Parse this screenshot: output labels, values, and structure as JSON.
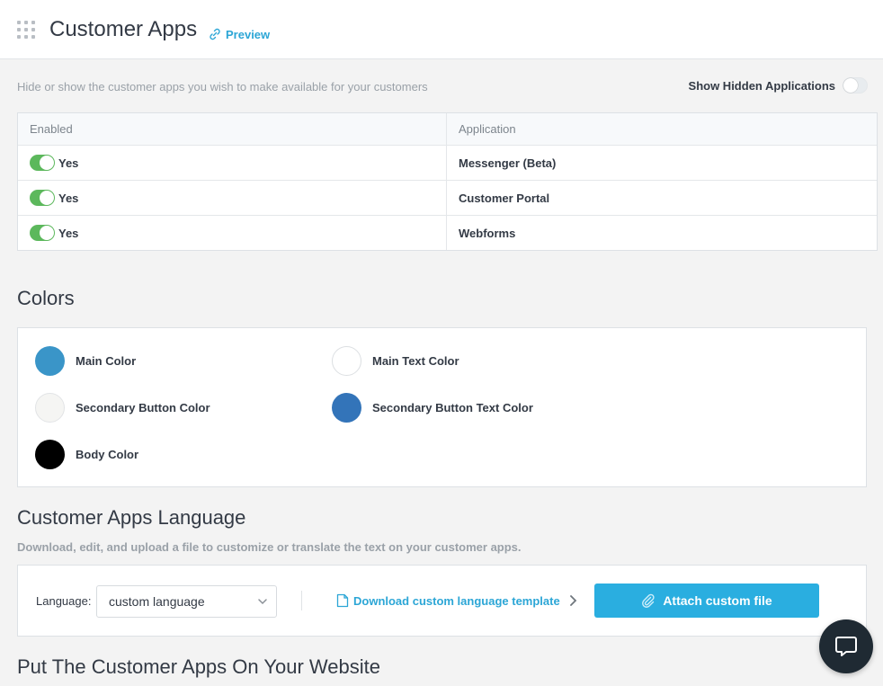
{
  "header": {
    "title": "Customer Apps",
    "preview_label": "Preview"
  },
  "apps": {
    "description": "Hide or show the customer apps you wish to make available for your customers",
    "show_hidden_label": "Show Hidden Applications",
    "show_hidden_enabled": false,
    "columns": [
      "Enabled",
      "Application"
    ],
    "rows": [
      {
        "enabled": "Yes",
        "application": "Messenger (Beta)"
      },
      {
        "enabled": "Yes",
        "application": "Customer Portal"
      },
      {
        "enabled": "Yes",
        "application": "Webforms"
      }
    ]
  },
  "colors": {
    "title": "Colors",
    "items": [
      {
        "label": "Main Color",
        "value": "#3a95c8"
      },
      {
        "label": "Main Text Color",
        "value": "#ffffff"
      },
      {
        "label": "Secondary Button Color",
        "value": "#f5f5f3"
      },
      {
        "label": "Secondary Button Text Color",
        "value": "#3374b9"
      },
      {
        "label": "Body Color",
        "value": "#000000"
      }
    ]
  },
  "language": {
    "title": "Customer Apps Language",
    "description": "Download, edit, and upload a file to customize or translate the text on your customer apps.",
    "label": "Language:",
    "selected": "custom language",
    "download_label": "Download custom language template",
    "attach_label": "Attach custom file"
  },
  "website": {
    "title": "Put The Customer Apps On Your Website"
  },
  "theme": {
    "accent": "#2ca6d6",
    "toggle_on": "#5cb85c",
    "button": "#2aaee0"
  }
}
